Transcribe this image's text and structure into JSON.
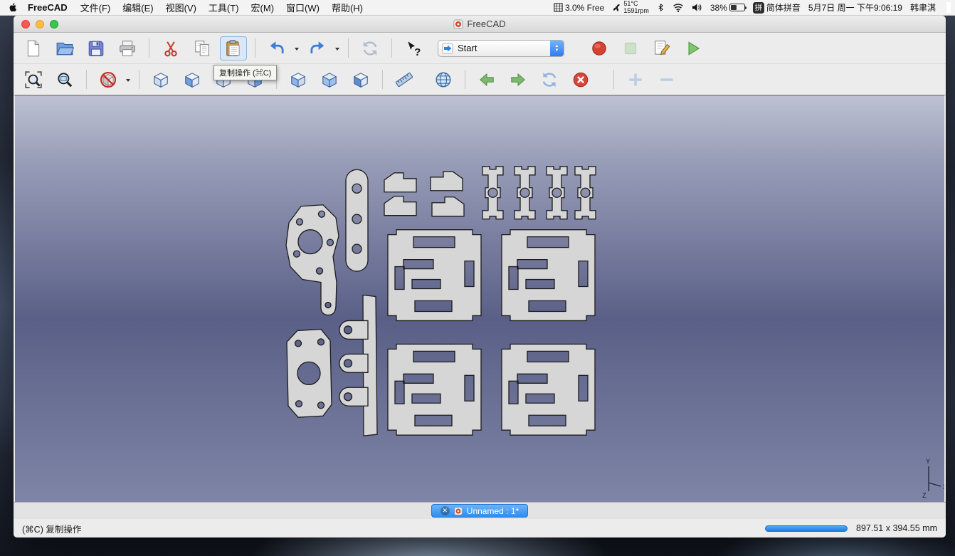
{
  "menu_bar": {
    "apple_menu_icon": "apple-logo-icon",
    "app_name": "FreeCAD",
    "menus": [
      "文件(F)",
      "编辑(E)",
      "视图(V)",
      "工具(T)",
      "宏(M)",
      "窗口(W)",
      "帮助(H)"
    ],
    "status": {
      "memory_free": "3.0% Free",
      "fan_temp": "51°C",
      "fan_rpm": "1591rpm",
      "battery_percent": "38%",
      "input_badge": "拼",
      "input_name": "简体拼音",
      "datetime": "5月7日 周一 下午9:06:19",
      "user_name": "韩聿淇"
    }
  },
  "window": {
    "title": "FreeCAD",
    "workbench_selector": {
      "value": "Start"
    },
    "tooltip": "复制操作 (⌘C)",
    "toolbar_file_icons": [
      "new-document",
      "open-folder",
      "save",
      "print",
      "cut",
      "copy",
      "paste",
      "undo",
      "redo",
      "refresh",
      "whats-this",
      "workbench-selector",
      "macro-record",
      "macro-stop",
      "macro-edit",
      "macro-run"
    ],
    "toolbar_view_icons": [
      "fit-all",
      "zoom-selection",
      "draw-style",
      "view-isometric",
      "view-front",
      "view-top",
      "view-right",
      "view-rear",
      "view-bottom",
      "view-left",
      "measure",
      "web-browser",
      "nav-back",
      "nav-forward",
      "page-refresh",
      "stop-loading",
      "zoom-in",
      "zoom-out"
    ],
    "viewport_axes": {
      "x": "X",
      "y": "Y",
      "z": "Z"
    },
    "document_tab": "Unnamed : 1*",
    "status_bar": {
      "message": "(⌘C) 复制操作",
      "dimensions": "897.51 x 394.55 mm"
    },
    "colors": {
      "tab_blue": "#3b97f2",
      "progress_blue": "#2f8de8",
      "viewport_top": "#bdc1d2",
      "viewport_mid": "#5a5f87",
      "viewport_bottom": "#7f85a6",
      "part_fill": "#d6d6d6"
    }
  }
}
